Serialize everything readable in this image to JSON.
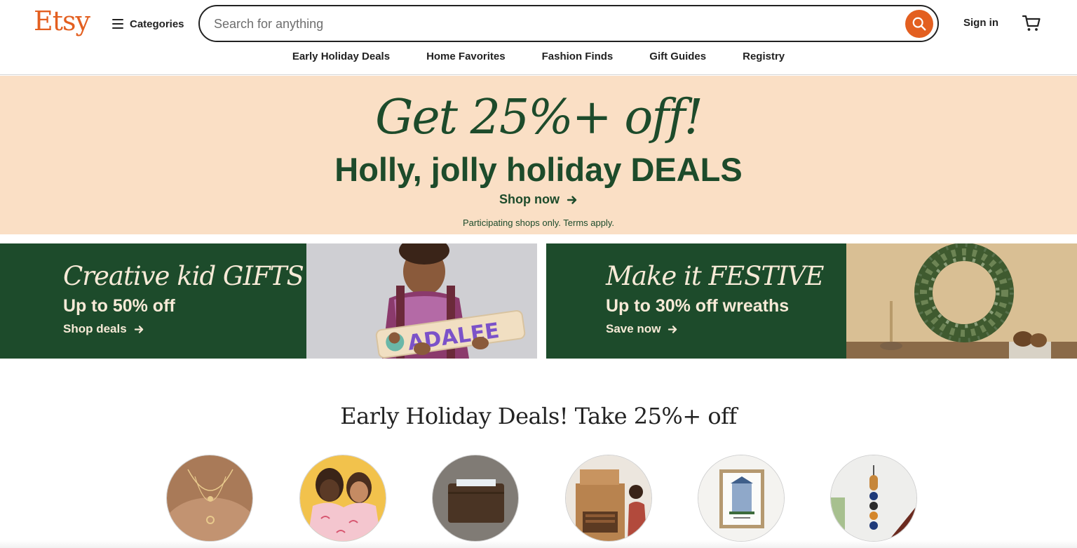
{
  "header": {
    "logo": "Etsy",
    "categories_label": "Categories",
    "search_placeholder": "Search for anything",
    "sign_in_label": "Sign in"
  },
  "nav": {
    "items": [
      "Early Holiday Deals",
      "Home Favorites",
      "Fashion Finds",
      "Gift Guides",
      "Registry"
    ]
  },
  "hero": {
    "script": "Get 25%+ off!",
    "title": "Holly, jolly holiday DEALS",
    "cta": "Shop now",
    "fine_print": "Participating shops only. Terms apply."
  },
  "promos": [
    {
      "script": "Creative kid GIFTS",
      "subtitle": "Up to 50% off",
      "cta": "Shop deals",
      "puzzle_name": "ADALEE"
    },
    {
      "script": "Make it FESTIVE",
      "subtitle": "Up to 30% off wreaths",
      "cta": "Save now"
    }
  ],
  "section": {
    "title": "Early Holiday Deals! Take 25%+ off"
  },
  "colors": {
    "brand_orange": "#e35f20",
    "forest_green": "#1d4b2b",
    "peach": "#fadfc5",
    "cream_text": "#f7ead7"
  },
  "icons": [
    "hamburger-icon",
    "search-icon",
    "cart-icon",
    "arrow-right-icon"
  ]
}
